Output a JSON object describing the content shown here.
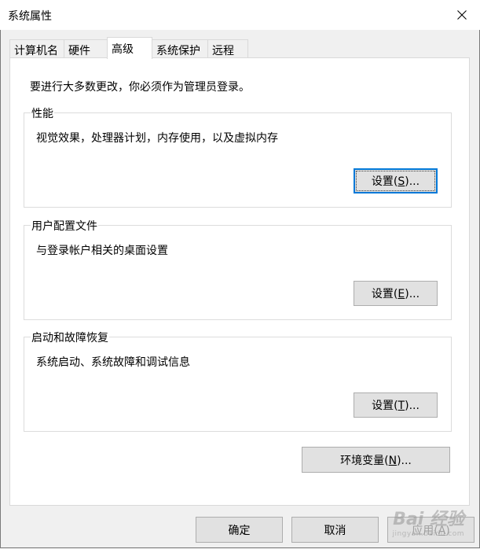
{
  "window": {
    "title": "系统属性",
    "close_icon": "close-icon"
  },
  "tabs": [
    {
      "label": "计算机名"
    },
    {
      "label": "硬件"
    },
    {
      "label": "高级",
      "active": true
    },
    {
      "label": "系统保护"
    },
    {
      "label": "远程"
    }
  ],
  "admin_note": "要进行大多数更改，你必须作为管理员登录。",
  "groups": {
    "performance": {
      "title": "性能",
      "description": "视觉效果，处理器计划，内存使用，以及虚拟内存",
      "button": {
        "text": "设置(",
        "accel": "S",
        "suffix": ")..."
      }
    },
    "user_profiles": {
      "title": "用户配置文件",
      "description": "与登录帐户相关的桌面设置",
      "button": {
        "text": "设置(",
        "accel": "E",
        "suffix": ")..."
      }
    },
    "startup_recovery": {
      "title": "启动和故障恢复",
      "description": "系统启动、系统故障和调试信息",
      "button": {
        "text": "设置(",
        "accel": "T",
        "suffix": ")..."
      }
    }
  },
  "env_button": {
    "text": "环境变量(",
    "accel": "N",
    "suffix": ")..."
  },
  "footer": {
    "ok": "确定",
    "cancel": "取消",
    "apply": {
      "text": "应用(",
      "accel": "A",
      "suffix": ")"
    }
  },
  "watermark": {
    "logo": "Bai 经验",
    "sub": "jingyan.baidu.com"
  },
  "colors": {
    "accent": "#0078d7",
    "panel_bg": "#ffffff",
    "window_bg": "#f0f0f0"
  }
}
